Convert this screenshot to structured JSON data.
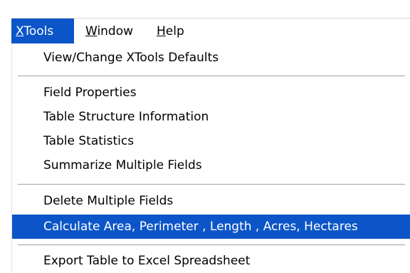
{
  "menubar": {
    "items": [
      {
        "mnemonic": "X",
        "rest": "Tools"
      },
      {
        "mnemonic": "W",
        "rest": "indow"
      },
      {
        "mnemonic": "H",
        "rest": "elp"
      }
    ]
  },
  "dropdown": {
    "items": [
      {
        "label": "View/Change XTools Defaults"
      },
      {
        "label": "Field Properties"
      },
      {
        "label": "Table Structure Information"
      },
      {
        "label": "Table Statistics"
      },
      {
        "label": "Summarize Multiple Fields"
      },
      {
        "label": "Delete Multiple Fields"
      },
      {
        "label": "Calculate Area, Perimeter , Length , Acres, Hectares"
      },
      {
        "label": "Export Table to Excel Spreadsheet"
      }
    ]
  },
  "colors": {
    "highlight": "#0c55c8",
    "highlight_text": "#ffffff",
    "text": "#000000"
  }
}
